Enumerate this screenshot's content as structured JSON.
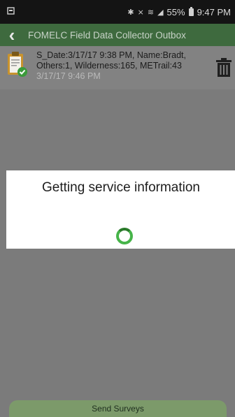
{
  "status_bar": {
    "battery_percent": "55%",
    "time": "9:47 PM"
  },
  "app_bar": {
    "title": "FOMELC Field Data Collector Outbox"
  },
  "outbox": {
    "items": [
      {
        "summary": "S_Date:3/17/17 9:38 PM, Name:Bradt, Others:1, Wilderness:165, METrail:43",
        "date": "3/17/17 9:46 PM"
      }
    ]
  },
  "dialog": {
    "message": "Getting service information"
  },
  "footer": {
    "send_label": "Send Surveys"
  },
  "colors": {
    "app_bar": "#3e6a3e",
    "spinner": "#46b449",
    "send_button": "#7c9a6a"
  }
}
